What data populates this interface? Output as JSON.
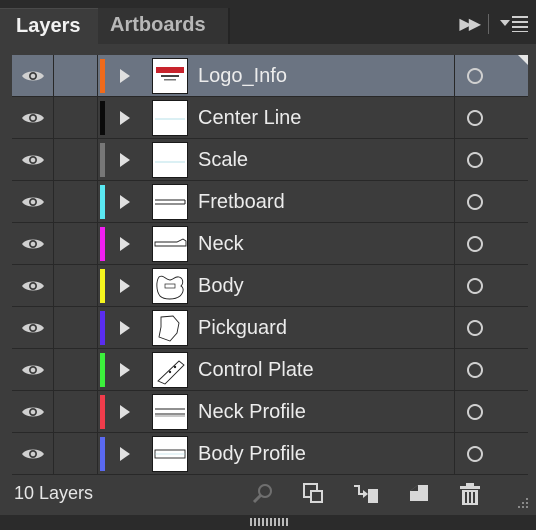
{
  "tabs": [
    {
      "label": "Layers",
      "active": true
    },
    {
      "label": "Artboards",
      "active": false
    }
  ],
  "panel_controls": {
    "collapse_icon": "double-chevron-right-icon",
    "menu_icon": "panel-menu-icon"
  },
  "layers": [
    {
      "name": "Logo_Info",
      "color": "#f06a1a",
      "thumbnail": "logo-thumbnail",
      "selected": true
    },
    {
      "name": "Center Line",
      "color": "#0a0a0a",
      "thumbnail": "center-line-thumbnail",
      "selected": false
    },
    {
      "name": "Scale",
      "color": "#777777",
      "thumbnail": "scale-thumbnail",
      "selected": false
    },
    {
      "name": "Fretboard",
      "color": "#5ae8f2",
      "thumbnail": "fretboard-thumbnail",
      "selected": false
    },
    {
      "name": "Neck",
      "color": "#f01ef0",
      "thumbnail": "neck-thumbnail",
      "selected": false
    },
    {
      "name": "Body",
      "color": "#f5f51e",
      "thumbnail": "body-thumbnail",
      "selected": false
    },
    {
      "name": "Pickguard",
      "color": "#5a2df0",
      "thumbnail": "pickguard-thumbnail",
      "selected": false
    },
    {
      "name": "Control Plate",
      "color": "#3cf03c",
      "thumbnail": "control-plate-thumbnail",
      "selected": false
    },
    {
      "name": "Neck Profile",
      "color": "#f03c4b",
      "thumbnail": "neck-profile-thumbnail",
      "selected": false
    },
    {
      "name": "Body Profile",
      "color": "#5a69f0",
      "thumbnail": "body-profile-thumbnail",
      "selected": false
    }
  ],
  "footer": {
    "layer_count": "10 Layers",
    "icons": [
      "search-icon",
      "clipping-mask-icon",
      "sublayer-icon",
      "new-layer-icon",
      "trash-icon"
    ]
  }
}
